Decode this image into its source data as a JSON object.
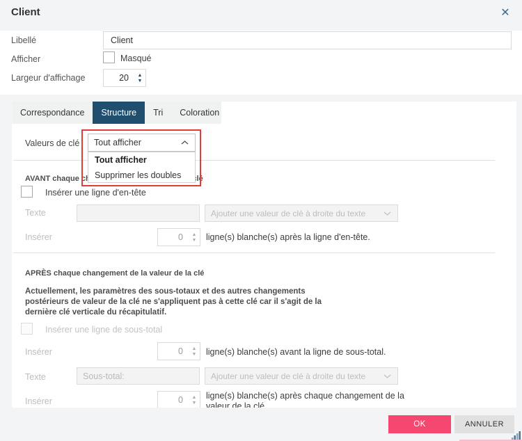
{
  "window": {
    "title": "Client",
    "close_icon": "✕"
  },
  "form": {
    "libelle_label": "Libellé",
    "libelle_value": "Client",
    "afficher_label": "Afficher",
    "masque_label": "Masqué",
    "largeur_label": "Largeur d'affichage",
    "largeur_value": "20"
  },
  "tabs": [
    {
      "label": "Correspondance"
    },
    {
      "label": "Structure"
    },
    {
      "label": "Tri"
    },
    {
      "label": "Coloration"
    }
  ],
  "structure": {
    "key_values_label": "Valeurs de clé",
    "key_values_selected": "Tout afficher",
    "key_values_options": [
      {
        "label": "Tout afficher"
      },
      {
        "label": "Supprimer les doubles"
      }
    ],
    "avant_heading": "AVANT chaque changement de la valeur de la clé",
    "header_checkbox_label": "Insérer une ligne d'en-tête",
    "texte_label": "Texte",
    "texte_value": "",
    "append_key_dropdown": "Ajouter une valeur de clé à droite du texte",
    "inserer_label": "Insérer",
    "header_spinner_value": "0",
    "header_after_text": "ligne(s) blanche(s) après la ligne d'en-tête.",
    "apres_heading": "APRÈS chaque changement de la valeur de la clé",
    "notice": "Actuellement, les paramètres des sous-totaux et des autres changements\npostérieurs de valeur de la clé ne s'appliquent pas à cette clé car il s'agit de la\ndernière clé verticale du récapitulatif.",
    "subtotal_checkbox_label": "Insérer une ligne de sous-total",
    "subtotal_before_spinner_value": "0",
    "subtotal_before_text": "ligne(s) blanche(s) avant la ligne de sous-total.",
    "subtotal_texte_value": "Sous-total:",
    "subtotal_after_spinner_value": "0",
    "subtotal_after_text": "ligne(s) blanche(s) après chaque changement de la valeur de la clé."
  },
  "footer": {
    "ok_label": "OK",
    "cancel_label": "ANNULER"
  },
  "colors": {
    "active_tab": "#1f4e6e",
    "ok_button": "#f5476f",
    "annotation_red": "#e23b3b",
    "spinner_arrows": "#1c4766"
  }
}
